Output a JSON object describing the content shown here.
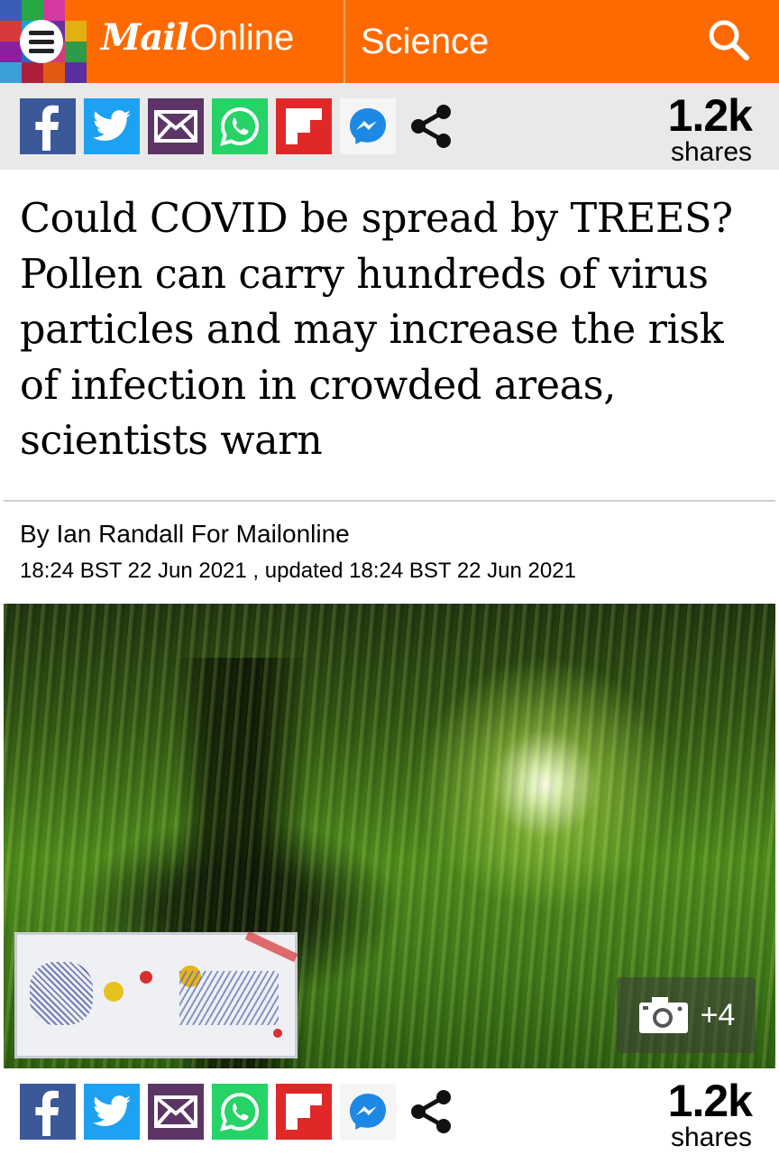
{
  "header": {
    "brand_mail": "Mail",
    "brand_online": "Online",
    "section": "Science",
    "icons": {
      "menu": "menu-icon",
      "search": "search-icon"
    },
    "colors": {
      "bar": "#ff6a00"
    }
  },
  "share_top": {
    "count": "1.2k",
    "count_label": "shares",
    "icons": [
      "facebook-icon",
      "twitter-icon",
      "email-icon",
      "whatsapp-icon",
      "flipboard-icon",
      "messenger-icon",
      "share-icon"
    ]
  },
  "article": {
    "headline": "Could COVID be spread by TREES? Pollen can carry hundreds of virus particles and may increase the risk of infection in crowded areas, scientists warn",
    "byline": "By Ian Randall For Mailonline",
    "dateline": "18:24 BST 22 Jun 2021 , updated 18:24 BST 22 Jun 2021",
    "image": {
      "gallery_count": "+4",
      "icons": {
        "gallery": "camera-icon"
      }
    }
  },
  "share_bottom": {
    "count": "1.2k",
    "count_label": "shares"
  }
}
